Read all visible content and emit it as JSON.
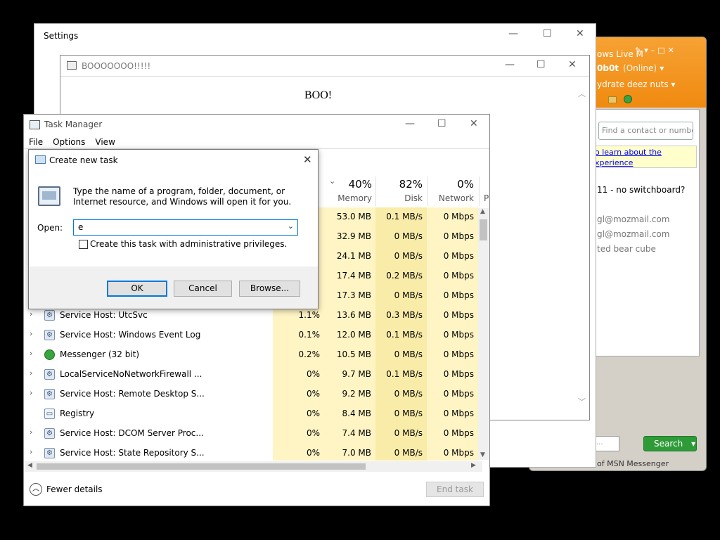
{
  "msn": {
    "title": "ows Live M",
    "user": "0b0t",
    "status": "(Online)",
    "personal_message": "ydrate deez nuts",
    "search_placeholder": "Find a contact or numbe",
    "ad_line1": "o learn about the",
    "ad_line2": "xperience",
    "contacts": [
      "11 - no switchboard?",
      "gl@mozmail.com",
      "gl@mozmail.com",
      "ted bear cube"
    ],
    "search_button": "Search",
    "search_field_value": "...",
    "footer": "of MSN Messenger"
  },
  "settings": {
    "title": "Settings"
  },
  "boo": {
    "title": "BOOOOOOO!!!!!",
    "message": "BOO!"
  },
  "task_manager": {
    "title": "Task Manager",
    "menu": [
      "File",
      "Options",
      "View"
    ],
    "columns": [
      {
        "pct": "40%",
        "label": "Memory"
      },
      {
        "pct": "82%",
        "label": "Disk"
      },
      {
        "pct": "0%",
        "label": "Network"
      },
      {
        "pct": "",
        "label": "P"
      }
    ],
    "hidden_rows": [
      {
        "memory": "53.0 MB",
        "disk": "0.1 MB/s",
        "network": "0 Mbps"
      },
      {
        "memory": "32.9 MB",
        "disk": "0 MB/s",
        "network": "0 Mbps"
      },
      {
        "memory": "24.1 MB",
        "disk": "0 MB/s",
        "network": "0 Mbps"
      },
      {
        "memory": "17.4 MB",
        "disk": "0.2 MB/s",
        "network": "0 Mbps"
      },
      {
        "memory": "17.3 MB",
        "disk": "0 MB/s",
        "network": "0 Mbps"
      }
    ],
    "rows": [
      {
        "name": "Service Host: UtcSvc",
        "cpu": "1.1%",
        "memory": "13.6 MB",
        "disk": "0.3 MB/s",
        "network": "0 Mbps"
      },
      {
        "name": "Service Host: Windows Event Log",
        "cpu": "0.1%",
        "memory": "12.0 MB",
        "disk": "0.1 MB/s",
        "network": "0 Mbps"
      },
      {
        "name": "Messenger (32 bit)",
        "cpu": "0.2%",
        "memory": "10.5 MB",
        "disk": "0 MB/s",
        "network": "0 Mbps"
      },
      {
        "name": "LocalServiceNoNetworkFirewall ...",
        "cpu": "0%",
        "memory": "9.7 MB",
        "disk": "0.1 MB/s",
        "network": "0 Mbps"
      },
      {
        "name": "Service Host: Remote Desktop S...",
        "cpu": "0%",
        "memory": "9.2 MB",
        "disk": "0 MB/s",
        "network": "0 Mbps"
      },
      {
        "name": "Registry",
        "cpu": "0%",
        "memory": "8.4 MB",
        "disk": "0 MB/s",
        "network": "0 Mbps"
      },
      {
        "name": "Service Host: DCOM Server Proc...",
        "cpu": "0%",
        "memory": "7.4 MB",
        "disk": "0 MB/s",
        "network": "0 Mbps"
      },
      {
        "name": "Service Host: State Repository S...",
        "cpu": "0%",
        "memory": "7.0 MB",
        "disk": "0 MB/s",
        "network": "0 Mbps"
      }
    ],
    "fewer_details": "Fewer details",
    "end_task": "End task"
  },
  "dialog": {
    "title": "Create new task",
    "description": "Type the name of a program, folder, document, or Internet resource, and Windows will open it for you.",
    "open_label": "Open:",
    "open_value": "e",
    "checkbox_label": "Create this task with administrative privileges.",
    "ok": "OK",
    "cancel": "Cancel",
    "browse": "Browse..."
  },
  "colors": {
    "heat_light": "#fff4c4",
    "heat_mid": "#f9eca8",
    "msn_orange": "#f08a10",
    "accent_blue": "#0078d7"
  }
}
